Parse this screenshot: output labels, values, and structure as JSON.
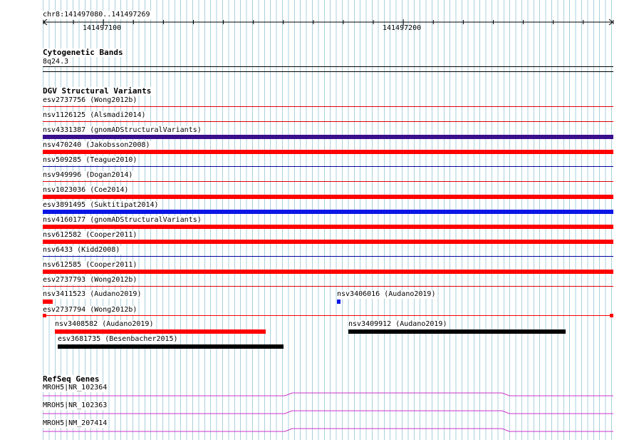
{
  "ruler": {
    "coordinates": "chr8:141497080..141497269",
    "ticks": [
      "141497100",
      "141497200"
    ]
  },
  "cytoband": {
    "title": "Cytogenetic Bands",
    "band": "8q24.3"
  },
  "dgv": {
    "title": "DGV Structural Variants",
    "rows": [
      {
        "label": "esv2737756 (Wong2012b)",
        "color": "#e0000a",
        "style": "thin"
      },
      {
        "label": "nsv1126125 (Alsmadi2014)",
        "color": "#e0000a",
        "style": "thin"
      },
      {
        "label": "nsv4331387 (gnomADStructuralVariants)",
        "color": "#3a0f8c",
        "style": "thick"
      },
      {
        "label": "nsv470240 (Jakobsson2008)",
        "color": "#ff0000",
        "style": "thick"
      },
      {
        "label": "nsv509285 (Teague2010)",
        "color": "#0000a0",
        "style": "thin"
      },
      {
        "label": "nsv949996 (Dogan2014)",
        "color": "#e0000a",
        "style": "thin"
      },
      {
        "label": "nsv1023036 (Coe2014)",
        "color": "#ff0000",
        "style": "thick"
      },
      {
        "label": "esv3891495 (Suktitipat2014)",
        "color": "#0a16e6",
        "style": "thick"
      },
      {
        "label": "nsv4160177 (gnomADStructuralVariants)",
        "color": "#ff0000",
        "style": "thick"
      },
      {
        "label": "nsv612582 (Cooper2011)",
        "color": "#ff0000",
        "style": "thick"
      },
      {
        "label": "nsv6433 (Kidd2008)",
        "color": "#0000a0",
        "style": "thin"
      },
      {
        "label": "nsv612585 (Cooper2011)",
        "color": "#ff0000",
        "style": "thick"
      },
      {
        "label": "esv2737793 (Wong2012b)",
        "color": "#e0000a",
        "style": "thin"
      }
    ],
    "partial": [
      {
        "label": "nsv3411523 (Audano2019)",
        "color": "#ff0000"
      },
      {
        "label": "nsv3406016 (Audano2019)",
        "color": "#0a16e6"
      },
      {
        "label": "esv2737794 (Wong2012b)",
        "color": "#ff0000"
      },
      {
        "label": "nsv3408582 (Audano2019)",
        "color": "#ff0000"
      },
      {
        "label": "nsv3409912 (Audano2019)",
        "color": "#000000"
      },
      {
        "label": "esv3681735 (Besenbacher2015)",
        "color": "#000000"
      }
    ]
  },
  "refseq": {
    "title": "RefSeq Genes",
    "color": "#cc33cc",
    "genes": [
      {
        "label": "MROH5|NR_102364"
      },
      {
        "label": "MROH5|NR_102363"
      },
      {
        "label": "MROH5|NM_207414"
      }
    ]
  }
}
